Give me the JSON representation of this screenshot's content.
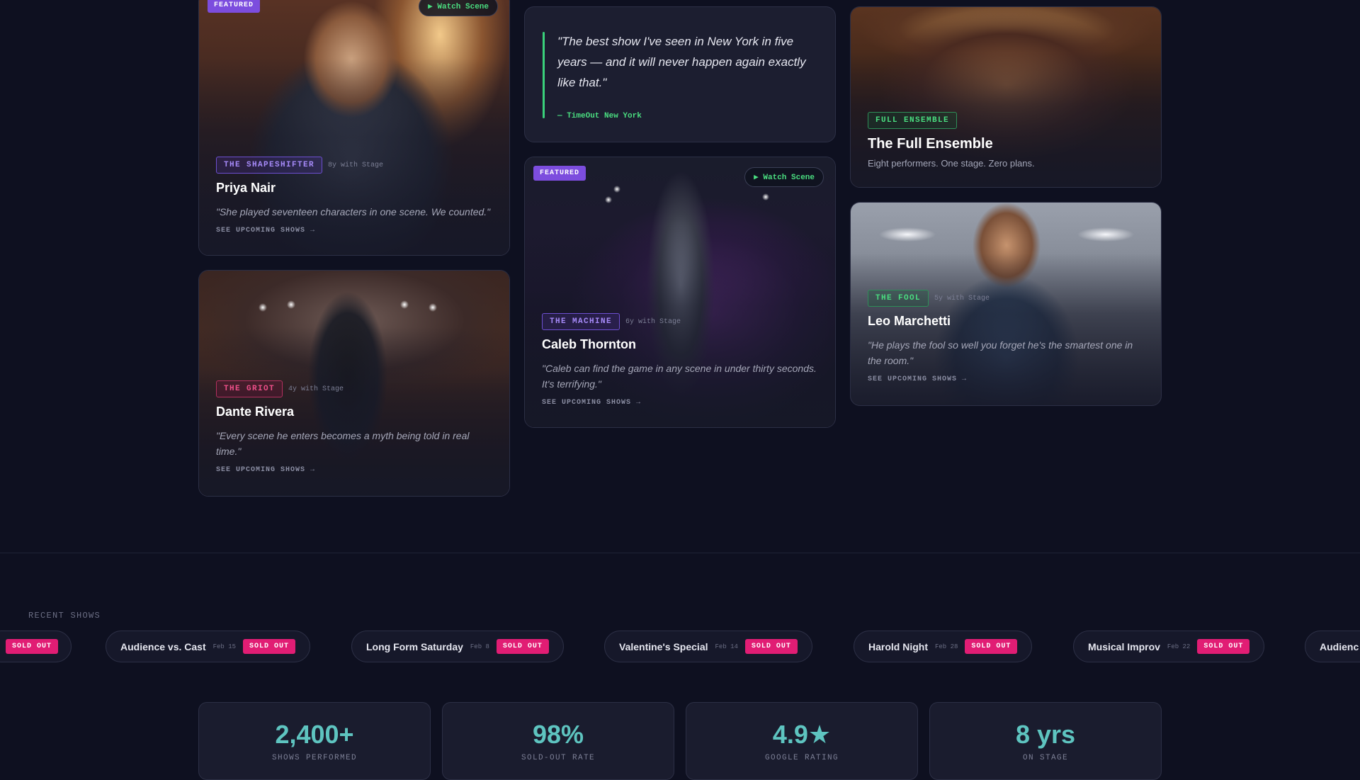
{
  "cards": {
    "priya": {
      "badge": "FEATURED",
      "watch": "▶ Watch Scene",
      "role": "THE SHAPESHIFTER",
      "meta": "8y with Stage",
      "name": "Priya Nair",
      "quote": "\"She played seventeen characters in one scene. We counted.\"",
      "link": "SEE UPCOMING SHOWS →"
    },
    "dante": {
      "role": "THE GRIOT",
      "meta": "4y with Stage",
      "name": "Dante Rivera",
      "quote": "\"Every scene he enters becomes a myth being told in real time.\"",
      "link": "SEE UPCOMING SHOWS →"
    },
    "caleb": {
      "badge": "FEATURED",
      "watch": "▶ Watch Scene",
      "role": "THE MACHINE",
      "meta": "6y with Stage",
      "name": "Caleb Thornton",
      "quote": "\"Caleb can find the game in any scene in under thirty seconds. It's terrifying.\"",
      "link": "SEE UPCOMING SHOWS →"
    },
    "ensemble": {
      "role": "FULL ENSEMBLE",
      "name": "The Full Ensemble",
      "subtitle": "Eight performers. One stage. Zero plans."
    },
    "leo": {
      "role": "THE FOOL",
      "meta": "5y with Stage",
      "name": "Leo Marchetti",
      "quote": "\"He plays the fool so well you forget he's the smartest one in the room.\"",
      "link": "SEE UPCOMING SHOWS →"
    }
  },
  "press_quote": {
    "text": "\"The best show I've seen in New York in five years — and it will never happen again exactly like that.\"",
    "source": "— TimeOut New York"
  },
  "recent": {
    "label": "RECENT SHOWS",
    "shows": [
      {
        "name": "",
        "date": "",
        "status": "SOLD OUT"
      },
      {
        "name": "Audience vs. Cast",
        "date": "Feb 15",
        "status": "SOLD OUT"
      },
      {
        "name": "Long Form Saturday",
        "date": "Feb 8",
        "status": "SOLD OUT"
      },
      {
        "name": "Valentine's Special",
        "date": "Feb 14",
        "status": "SOLD OUT"
      },
      {
        "name": "Harold Night",
        "date": "Feb 28",
        "status": "SOLD OUT"
      },
      {
        "name": "Musical Improv",
        "date": "Feb 22",
        "status": "SOLD OUT"
      },
      {
        "name": "Audienc",
        "date": "",
        "status": ""
      }
    ]
  },
  "stats": [
    {
      "value": "2,400+",
      "label": "SHOWS PERFORMED"
    },
    {
      "value": "98%",
      "label": "SOLD-OUT RATE"
    },
    {
      "value": "4.9★",
      "label": "GOOGLE RATING"
    },
    {
      "value": "8 yrs",
      "label": "ON STAGE"
    }
  ],
  "colors": {
    "background": "#0e1020",
    "accent_green": "#4ade80",
    "accent_purple": "#7c4dde",
    "sold_out_pink": "#e11d74",
    "stat_teal": "#5ec4c0"
  }
}
